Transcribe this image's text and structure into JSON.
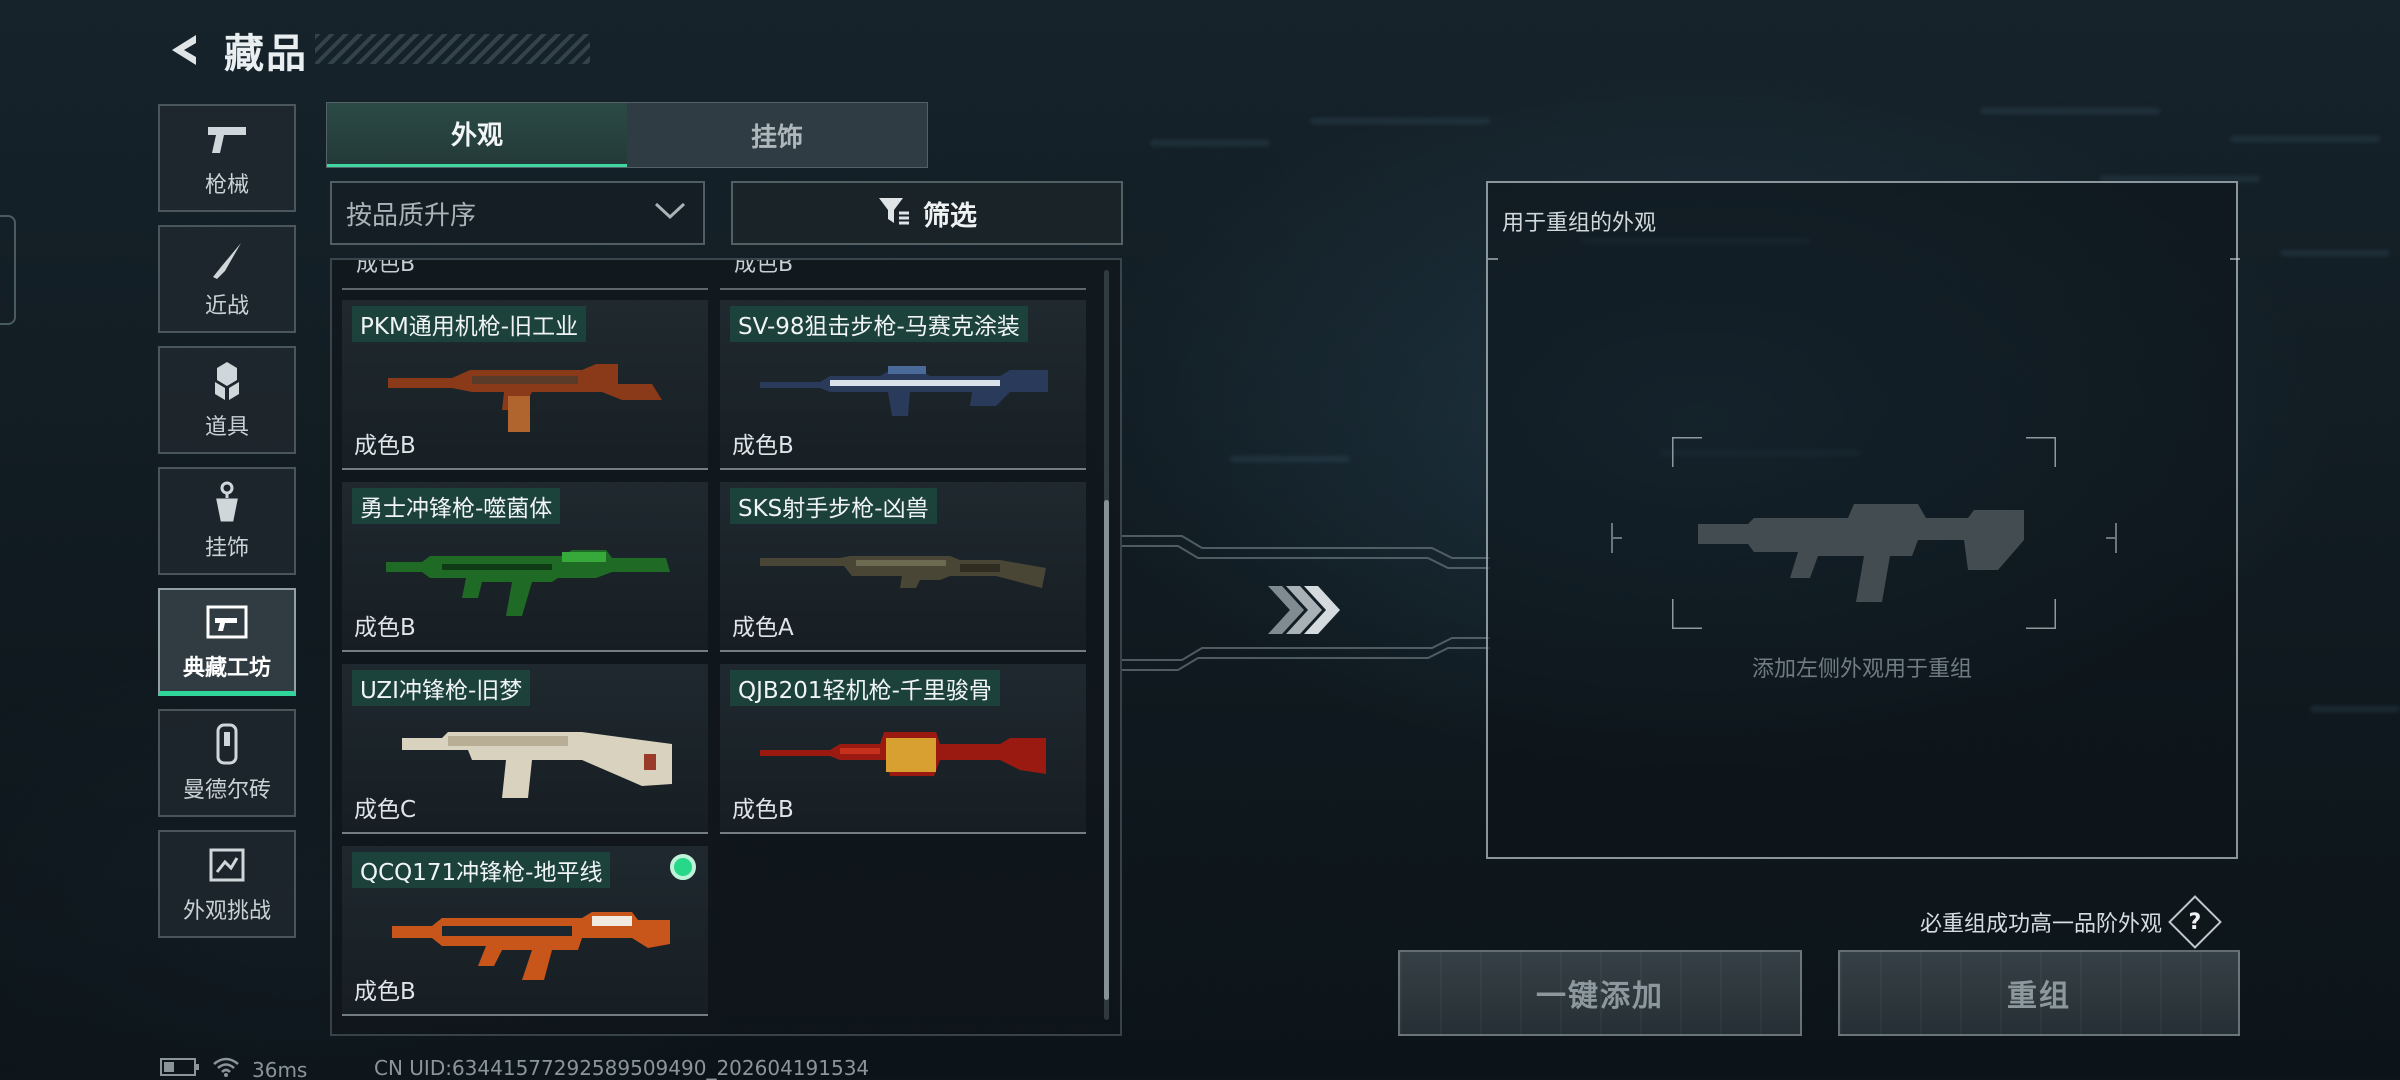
{
  "header": {
    "title": "藏品"
  },
  "sidebar": {
    "items": [
      {
        "label": "枪械",
        "icon": "pistol-icon"
      },
      {
        "label": "近战",
        "icon": "knife-icon"
      },
      {
        "label": "道具",
        "icon": "grenade-icon"
      },
      {
        "label": "挂饰",
        "icon": "charm-icon"
      },
      {
        "label": "典藏工坊",
        "icon": "workshop-icon",
        "active": true
      },
      {
        "label": "曼德尔砖",
        "icon": "mandel-brick-icon"
      },
      {
        "label": "外观挑战",
        "icon": "challenge-icon"
      }
    ]
  },
  "tabs": [
    {
      "label": "外观",
      "active": true
    },
    {
      "label": "挂饰",
      "active": false
    }
  ],
  "sort": {
    "label": "按品质升序"
  },
  "filter": {
    "label": "筛选"
  },
  "list": {
    "peek_left": "成色B",
    "peek_right": "成色B",
    "items": [
      {
        "name": "PKM通用机枪-旧工业",
        "grade": "成色B",
        "palette": [
          "#8a3a18",
          "#5a3a28",
          "#b0652e"
        ]
      },
      {
        "name": "SV-98狙击步枪-马赛克涂装",
        "grade": "成色B",
        "palette": [
          "#2a3a5a",
          "#d9e2ea",
          "#4a6a9a"
        ]
      },
      {
        "name": "勇士冲锋枪-噬菌体",
        "grade": "成色B",
        "palette": [
          "#1f6a25",
          "#37a83a",
          "#0f3a14"
        ]
      },
      {
        "name": "SKS射手步枪-凶兽",
        "grade": "成色A",
        "palette": [
          "#4a4636",
          "#6d6a52",
          "#2f2c22"
        ]
      },
      {
        "name": "UZI冲锋枪-旧梦",
        "grade": "成色C",
        "palette": [
          "#d8d2bf",
          "#b8ae96",
          "#9a3a2a"
        ]
      },
      {
        "name": "QJB201轻机枪-千里骏骨",
        "grade": "成色B",
        "palette": [
          "#9a1a12",
          "#c8301e",
          "#d8a030"
        ]
      },
      {
        "name": "QCQ171冲锋枪-地平线",
        "grade": "成色B",
        "palette": [
          "#c8561a",
          "#1a2630",
          "#f0eae0"
        ],
        "selected": true
      }
    ]
  },
  "recombine": {
    "title": "用于重组的外观",
    "hint": "添加左侧外观用于重组"
  },
  "guarantee": {
    "text": "必重组成功高一品阶外观",
    "help": "?"
  },
  "buttons": {
    "add_all": "一键添加",
    "recombine": "重组"
  },
  "status": {
    "ping": "36ms",
    "uid": "CN UID:6344157729258950949​0_202604191534"
  }
}
